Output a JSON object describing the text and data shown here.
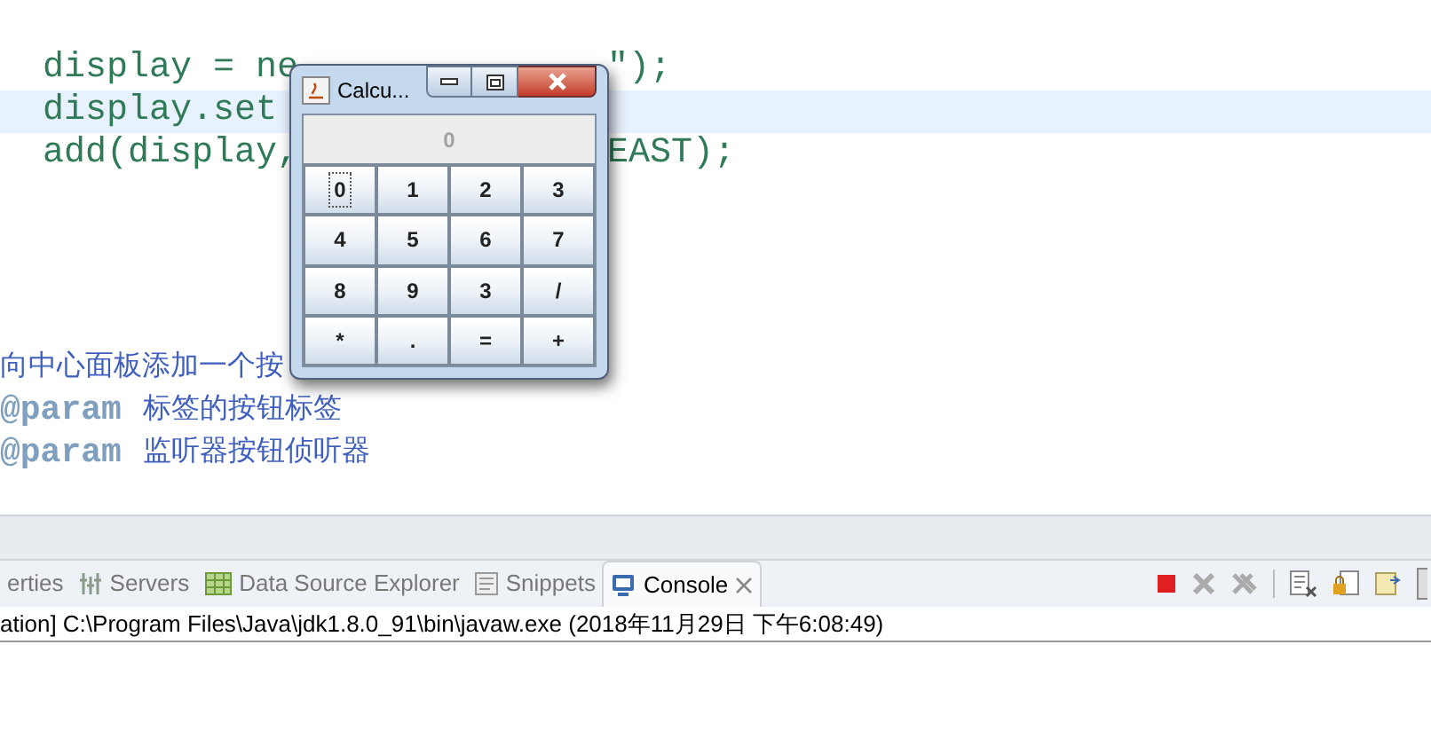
{
  "editor": {
    "code_lines": [
      {
        "left": "display = ne",
        "right": "\");",
        "highlighted": false
      },
      {
        "left": "display.set",
        "highlighted": true
      },
      {
        "left": "add(display,",
        "right": "EAST);",
        "highlighted": false
      }
    ],
    "comment_lines": [
      {
        "text": "向中心面板添加一个按"
      },
      {
        "tag": "@param",
        "text": "标签的按钮标签"
      },
      {
        "tag": "@param",
        "text": "监听器按钮侦听器"
      }
    ]
  },
  "calculator": {
    "title": "Calcu...",
    "display": "0",
    "keys": [
      {
        "label": "0",
        "focused": true
      },
      {
        "label": "1",
        "focused": false
      },
      {
        "label": "2",
        "focused": false
      },
      {
        "label": "3",
        "focused": false
      },
      {
        "label": "4",
        "focused": false
      },
      {
        "label": "5",
        "focused": false
      },
      {
        "label": "6",
        "focused": false
      },
      {
        "label": "7",
        "focused": false
      },
      {
        "label": "8",
        "focused": false
      },
      {
        "label": "9",
        "focused": false
      },
      {
        "label": "3",
        "focused": false
      },
      {
        "label": "/",
        "focused": false
      },
      {
        "label": "*",
        "focused": false
      },
      {
        "label": ".",
        "focused": false
      },
      {
        "label": "=",
        "focused": false
      },
      {
        "label": "+",
        "focused": false
      }
    ]
  },
  "tabs": [
    {
      "label": "erties",
      "kind": "none",
      "selected": false
    },
    {
      "label": "Servers",
      "kind": "servers",
      "selected": false
    },
    {
      "label": "Data Source Explorer",
      "kind": "database",
      "selected": false
    },
    {
      "label": "Snippets",
      "kind": "snippets",
      "selected": false
    },
    {
      "label": "Console",
      "kind": "console",
      "selected": true
    }
  ],
  "console": {
    "launch_line": "ation] C:\\Program Files\\Java\\jdk1.8.0_91\\bin\\javaw.exe (2018年11月29日 下午6:08:49)"
  }
}
